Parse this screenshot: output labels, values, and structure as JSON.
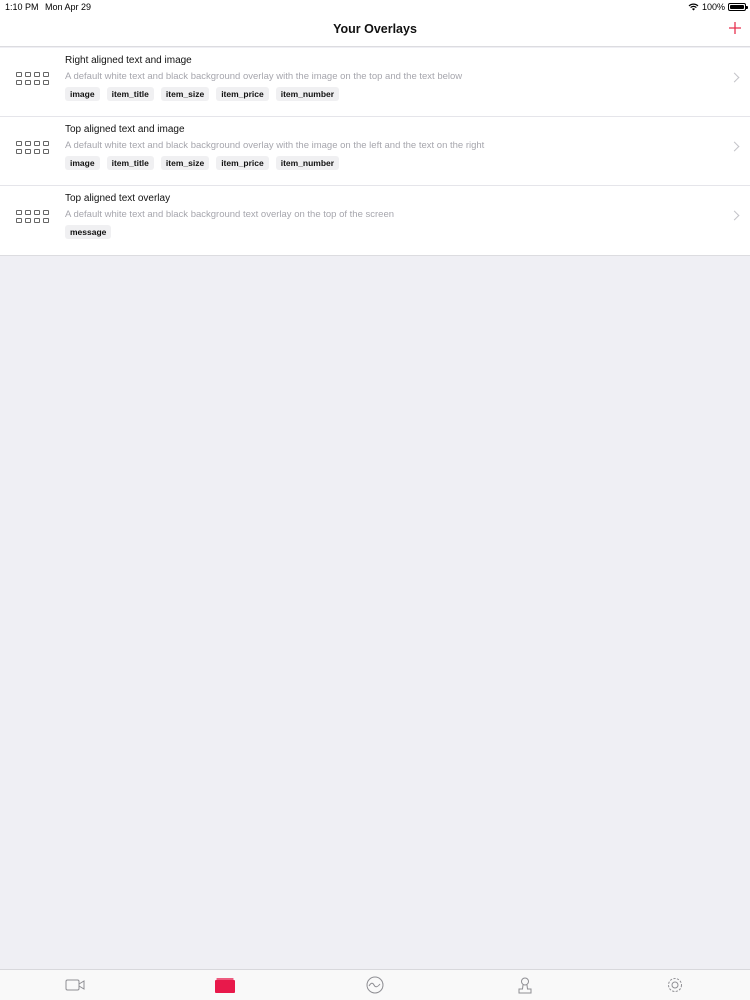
{
  "status_bar": {
    "time": "1:10 PM",
    "date": "Mon Apr 29",
    "wifi_icon": "wifi-icon",
    "battery_percent": "100%",
    "battery_level": 1.0
  },
  "nav": {
    "title": "Your Overlays",
    "add_icon": "plus-icon",
    "accent_color": "#e8314f"
  },
  "overlays": [
    {
      "title": "Right aligned text and image",
      "description": "A default white text and black background overlay with the image on the top and the text below",
      "tags": [
        "image",
        "item_title",
        "item_size",
        "item_price",
        "item_number"
      ]
    },
    {
      "title": "Top aligned text and image",
      "description": "A default white text and black background overlay with the image on the left and the text on the right",
      "tags": [
        "image",
        "item_title",
        "item_size",
        "item_price",
        "item_number"
      ]
    },
    {
      "title": "Top aligned text overlay",
      "description": "A default white text and black background text overlay on the top of the screen",
      "tags": [
        "message"
      ]
    }
  ],
  "tab_bar": {
    "items": [
      {
        "icon": "video-camera-icon",
        "selected": false
      },
      {
        "icon": "overlay-folder-icon",
        "selected": true
      },
      {
        "icon": "activity-wave-icon",
        "selected": false
      },
      {
        "icon": "user-icon",
        "selected": false
      },
      {
        "icon": "gear-icon",
        "selected": false
      }
    ],
    "selected_color": "#e8314f",
    "default_color": "#8e8e93"
  }
}
